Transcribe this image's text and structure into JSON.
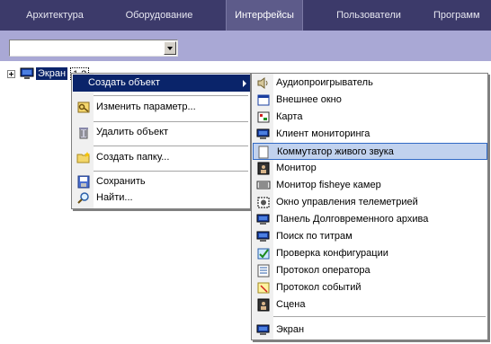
{
  "tabs": [
    {
      "label": "Архитектура"
    },
    {
      "label": "Оборудование"
    },
    {
      "label": "Интерфейсы"
    },
    {
      "label": "Пользователи"
    },
    {
      "label": "Программ"
    }
  ],
  "active_tab": "Интерфейсы",
  "filter_combo": {
    "value": ""
  },
  "tree": {
    "root_label": "Экран",
    "root_number": "1 2",
    "root_icon": "monitor-icon"
  },
  "context_menu": {
    "items": [
      {
        "label": "Создать объект",
        "icon": "",
        "submenu": true
      },
      {
        "label": "Изменить параметр...",
        "icon": "edit-key-icon"
      },
      {
        "label": "Удалить объект",
        "icon": "delete-icon"
      },
      {
        "label": "Создать папку...",
        "icon": "new-folder-icon"
      },
      {
        "label": "Сохранить",
        "icon": "save-icon"
      },
      {
        "label": "Найти...",
        "icon": "find-icon"
      }
    ]
  },
  "submenu": {
    "items": [
      {
        "label": "Аудиопроигрыватель",
        "icon": "speaker-icon"
      },
      {
        "label": "Внешнее окно",
        "icon": "window-icon"
      },
      {
        "label": "Карта",
        "icon": "map-icon"
      },
      {
        "label": "Клиент мониторинга",
        "icon": "monitor-client-icon"
      },
      {
        "label": "Коммутатор живого звука",
        "icon": "sound-switch-icon"
      },
      {
        "label": "Монитор",
        "icon": "monitor-icon"
      },
      {
        "label": "Монитор fisheye камер",
        "icon": "fisheye-monitor-icon"
      },
      {
        "label": "Окно управления телеметрией",
        "icon": "telemetry-icon"
      },
      {
        "label": "Панель Долговременного архива",
        "icon": "archive-panel-icon"
      },
      {
        "label": "Поиск по титрам",
        "icon": "titles-search-icon"
      },
      {
        "label": "Проверка конфигурации",
        "icon": "config-check-icon"
      },
      {
        "label": "Протокол оператора",
        "icon": "operator-log-icon"
      },
      {
        "label": "Протокол событий",
        "icon": "events-log-icon"
      },
      {
        "label": "Сцена",
        "icon": "scene-icon"
      },
      {
        "label": "Экран",
        "icon": "screen-icon"
      }
    ],
    "highlighted": "Коммутатор живого звука"
  },
  "colors": {
    "tabbar": "#3c3a6a",
    "toolbar": "#a9a8d5",
    "selection": "#0a246a",
    "hover": "#c1d2ee"
  }
}
